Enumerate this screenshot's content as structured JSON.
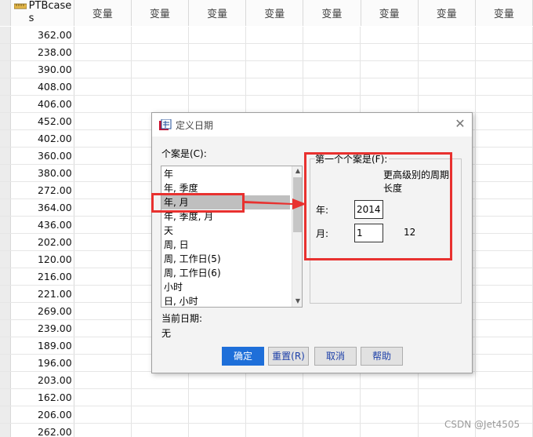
{
  "spreadsheet": {
    "first_column_header": "PTBcases",
    "variable_header": "变量",
    "variable_column_count": 8,
    "values": [
      "362.00",
      "238.00",
      "390.00",
      "408.00",
      "406.00",
      "452.00",
      "402.00",
      "360.00",
      "380.00",
      "272.00",
      "364.00",
      "436.00",
      "202.00",
      "120.00",
      "216.00",
      "221.00",
      "269.00",
      "239.00",
      "189.00",
      "196.00",
      "203.00",
      "162.00",
      "206.00",
      "262.00"
    ]
  },
  "dialog": {
    "title": "定义日期",
    "cases_label": "个案是(C):",
    "case_options": [
      "年",
      "年, 季度",
      "年, 月",
      "年, 季度, 月",
      "天",
      "周, 日",
      "周, 工作日(5)",
      "周, 工作日(6)",
      "小时",
      "日, 小时"
    ],
    "selected_option": "年, 月",
    "current_dates_label": "当前日期:",
    "current_dates_value": "无",
    "first_case_label": "第一个个案是(F):",
    "higher_level_label": "更高级别的周期长度",
    "year_label": "年:",
    "year_value": "2014",
    "month_label": "月:",
    "month_value": "1",
    "month_periodicity": "12",
    "buttons": {
      "ok": "确定",
      "reset": "重置(R)",
      "cancel": "取消",
      "help": "帮助"
    }
  },
  "watermark": "CSDN @Jet4505",
  "colors": {
    "annotation": "#e8312f",
    "primary_button": "#1e6fd9",
    "selection": "#bfbfbf"
  }
}
